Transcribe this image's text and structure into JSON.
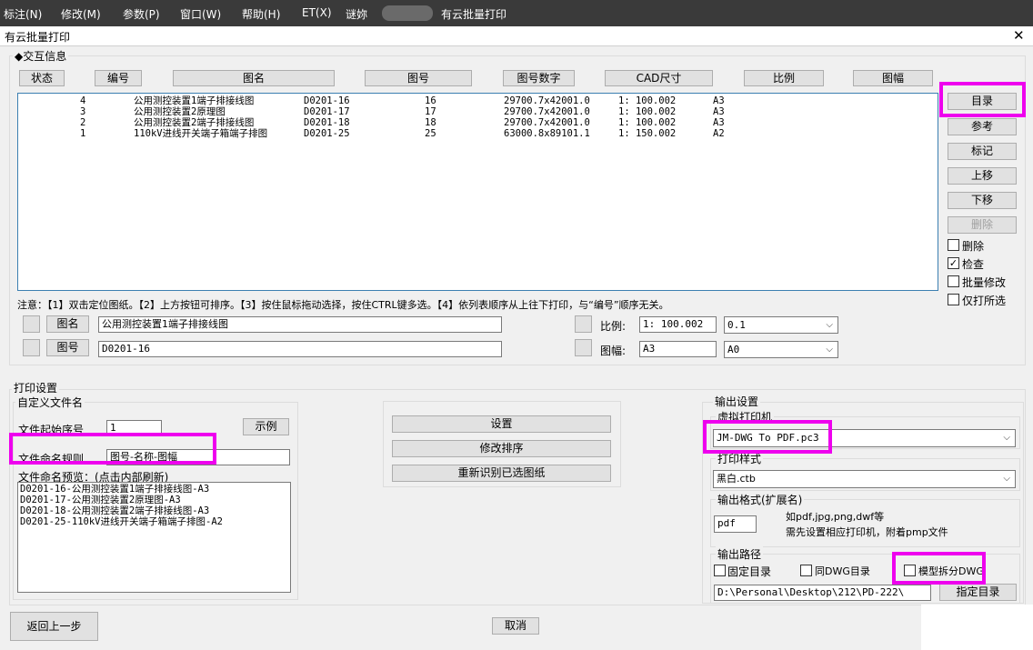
{
  "menubar": {
    "items": [
      "标注(N)",
      "修改(M)",
      "参数(P)",
      "窗口(W)",
      "帮助(H)",
      "ET(X)",
      "谜妳"
    ],
    "app_title": "有云批量打印"
  },
  "window": {
    "title": "有云批量打印",
    "close_glyph": "✕"
  },
  "interactive": {
    "group_title": "◆交互信息",
    "column_headers": [
      "状态",
      "编号",
      "图名",
      "图号",
      "图号数字",
      "CAD尺寸",
      "比例",
      "图幅"
    ],
    "rows": [
      [
        "4",
        "公用测控装置1端子排接线图",
        "D0201-16",
        "16",
        "29700.7x42001.0",
        "1: 100.002",
        "A3"
      ],
      [
        "3",
        "公用测控装置2原理图",
        "D0201-17",
        "17",
        "29700.7x42001.0",
        "1: 100.002",
        "A3"
      ],
      [
        "2",
        "公用测控装置2端子排接线图",
        "D0201-18",
        "18",
        "29700.7x42001.0",
        "1: 100.002",
        "A3"
      ],
      [
        "1",
        "110kV进线开关端子箱端子排图",
        "D0201-25",
        "25",
        "63000.8x89101.1",
        "1: 150.002",
        "A2"
      ]
    ],
    "side_buttons": {
      "catalog": "目录",
      "reference": "参考",
      "mark": "标记",
      "move_up": "上移",
      "move_down": "下移",
      "delete": "删除"
    },
    "checkboxes": [
      {
        "label": "删除",
        "checked": false
      },
      {
        "label": "检查",
        "checked": true
      },
      {
        "label": "批量修改",
        "checked": false
      },
      {
        "label": "仅打所选",
        "checked": false
      }
    ],
    "notice": "注意：【1】双击定位图纸。【2】上方按钮可排序。【3】按住鼠标拖动选择，按住CTRL键多选。【4】依列表顺序从上往下打印，与“编号”顺序无关。",
    "name_button": "图名",
    "name_value": "公用测控装置1端子排接线图",
    "number_button": "图号",
    "number_value": "D0201-16",
    "scale_label": "比例:",
    "scale_value": "1: 100.002",
    "scale_select": "0.1",
    "size_label": "图幅:",
    "size_value": "A3",
    "size_select": "A0"
  },
  "print_settings": {
    "title": "打印设置",
    "custom_filename": {
      "title": "自定义文件名",
      "start_label": "文件起始序号",
      "start_value": "1",
      "example_button": "示例",
      "rule_label": "文件命名规则",
      "rule_value": "图号-名称-图幅",
      "preview_label": "文件命名预览：(点击内部刷新)",
      "preview_lines": [
        "D0201-16-公用测控装置1端子排接线图-A3",
        "D0201-17-公用测控装置2原理图-A3",
        "D0201-18-公用测控装置2端子排接线图-A3",
        "D0201-25-110kV进线开关端子箱端子排图-A2"
      ]
    },
    "middle_buttons": {
      "settings": "设置",
      "modify_order": "修改排序",
      "reidentify": "重新识别已选图纸"
    }
  },
  "output": {
    "title": "输出设置",
    "printer_title": "虚拟打印机",
    "printer_value": "JM-DWG To PDF.pc3",
    "style_title": "打印样式",
    "style_value": "黑白.ctb",
    "format_title": "输出格式(扩展名)",
    "format_value": "pdf",
    "format_hint_1": "如pdf,jpg,png,dwf等",
    "format_hint_2": "需先设置相应打印机，附着pmp文件",
    "path_title": "输出路径",
    "fixed_dir": "固定目录",
    "same_dwg_dir": "同DWG目录",
    "split_model": "模型拆分DWG",
    "path_value": "D:\\Personal\\Desktop\\212\\PD-222\\",
    "choose_dir_button": "指定目录"
  },
  "footer": {
    "back_button": "返回上一步",
    "cancel_button": "取消"
  },
  "colors": {
    "highlight": "#ee00ee",
    "list_border": "#3c7fb1",
    "menubar": "#3a3a3a"
  }
}
